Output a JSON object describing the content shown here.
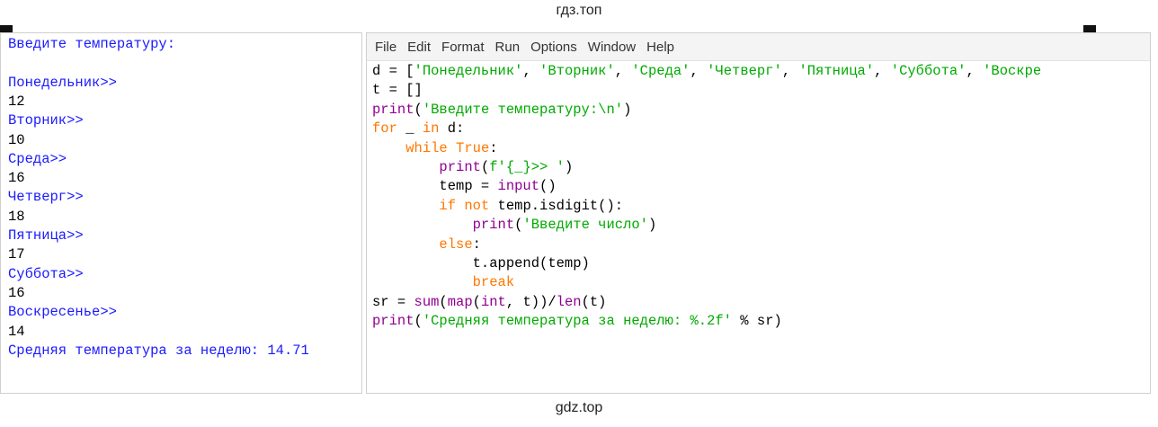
{
  "watermark": {
    "top": "гдз.топ",
    "bottom": "gdz.top"
  },
  "shell": {
    "lines": [
      {
        "text": "Введите температуру:",
        "kind": "prompt"
      },
      {
        "text": "",
        "kind": "prompt"
      },
      {
        "text": "Понедельник>>",
        "kind": "prompt"
      },
      {
        "text": "12",
        "kind": "input"
      },
      {
        "text": "Вторник>>",
        "kind": "prompt"
      },
      {
        "text": "10",
        "kind": "input"
      },
      {
        "text": "Среда>>",
        "kind": "prompt"
      },
      {
        "text": "16",
        "kind": "input"
      },
      {
        "text": "Четверг>>",
        "kind": "prompt"
      },
      {
        "text": "18",
        "kind": "input"
      },
      {
        "text": "Пятница>>",
        "kind": "prompt"
      },
      {
        "text": "17",
        "kind": "input"
      },
      {
        "text": "Суббота>>",
        "kind": "prompt"
      },
      {
        "text": "16",
        "kind": "input"
      },
      {
        "text": "Воскресенье>>",
        "kind": "prompt"
      },
      {
        "text": "14",
        "kind": "input"
      },
      {
        "text": "Средняя температура за неделю: 14.71",
        "kind": "prompt"
      }
    ]
  },
  "editor": {
    "menu": [
      "File",
      "Edit",
      "Format",
      "Run",
      "Options",
      "Window",
      "Help"
    ],
    "code": [
      [
        [
          "pl",
          "d = ["
        ],
        [
          "str",
          "'Понедельник'"
        ],
        [
          "pl",
          ", "
        ],
        [
          "str",
          "'Вторник'"
        ],
        [
          "pl",
          ", "
        ],
        [
          "str",
          "'Среда'"
        ],
        [
          "pl",
          ", "
        ],
        [
          "str",
          "'Четверг'"
        ],
        [
          "pl",
          ", "
        ],
        [
          "str",
          "'Пятница'"
        ],
        [
          "pl",
          ", "
        ],
        [
          "str",
          "'Суббота'"
        ],
        [
          "pl",
          ", "
        ],
        [
          "str",
          "'Воскре"
        ]
      ],
      [
        [
          "pl",
          "t = []"
        ]
      ],
      [
        [
          "bi",
          "print"
        ],
        [
          "pl",
          "("
        ],
        [
          "str",
          "'Введите температуру:\\n'"
        ],
        [
          "pl",
          ")"
        ]
      ],
      [
        [
          "kw",
          "for"
        ],
        [
          "pl",
          " _ "
        ],
        [
          "kw",
          "in"
        ],
        [
          "pl",
          " d:"
        ]
      ],
      [
        [
          "pl",
          "    "
        ],
        [
          "kw",
          "while"
        ],
        [
          "pl",
          " "
        ],
        [
          "kw",
          "True"
        ],
        [
          "pl",
          ":"
        ]
      ],
      [
        [
          "pl",
          "        "
        ],
        [
          "bi",
          "print"
        ],
        [
          "pl",
          "("
        ],
        [
          "str",
          "f'{_}>> '"
        ],
        [
          "pl",
          ")"
        ]
      ],
      [
        [
          "pl",
          "        temp = "
        ],
        [
          "bi",
          "input"
        ],
        [
          "pl",
          "()"
        ]
      ],
      [
        [
          "pl",
          "        "
        ],
        [
          "kw",
          "if"
        ],
        [
          "pl",
          " "
        ],
        [
          "kw",
          "not"
        ],
        [
          "pl",
          " temp.isdigit():"
        ]
      ],
      [
        [
          "pl",
          "            "
        ],
        [
          "bi",
          "print"
        ],
        [
          "pl",
          "("
        ],
        [
          "str",
          "'Введите число'"
        ],
        [
          "pl",
          ")"
        ]
      ],
      [
        [
          "pl",
          "        "
        ],
        [
          "kw",
          "else"
        ],
        [
          "pl",
          ":"
        ]
      ],
      [
        [
          "pl",
          "            t.append(temp)"
        ]
      ],
      [
        [
          "pl",
          "            "
        ],
        [
          "kw",
          "break"
        ]
      ],
      [
        [
          "pl",
          "sr = "
        ],
        [
          "bi",
          "sum"
        ],
        [
          "pl",
          "("
        ],
        [
          "bi",
          "map"
        ],
        [
          "pl",
          "("
        ],
        [
          "bi",
          "int"
        ],
        [
          "pl",
          ", t))/"
        ],
        [
          "bi",
          "len"
        ],
        [
          "pl",
          "(t)"
        ]
      ],
      [
        [
          "bi",
          "print"
        ],
        [
          "pl",
          "("
        ],
        [
          "str",
          "'Средняя температура за неделю: %.2f'"
        ],
        [
          "pl",
          " % sr)"
        ]
      ]
    ]
  }
}
